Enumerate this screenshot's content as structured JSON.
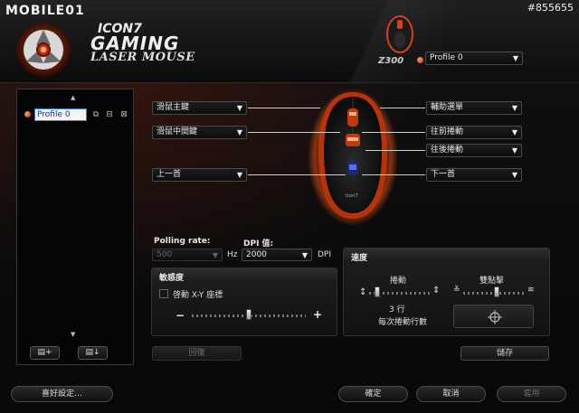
{
  "watermark": {
    "text": "MOBILE01",
    "photo_id": "#855655"
  },
  "brand": {
    "sub": "ICON7",
    "title": "GAMING",
    "tag": "LASER MOUSE"
  },
  "model": {
    "name": "Z300",
    "profile_selected": "Profile 0"
  },
  "profiles": {
    "items": [
      {
        "name": "Profile 0"
      }
    ],
    "add_button": "▤+",
    "import_button": "▤↓"
  },
  "buttons_map": {
    "left": [
      {
        "label": "滑鼠主鍵"
      },
      {
        "label": "滑鼠中間鍵"
      },
      {
        "label": "上一首"
      }
    ],
    "right": [
      {
        "label": "輔助選單"
      },
      {
        "label": "往前捲動"
      },
      {
        "label": "往後捲動"
      },
      {
        "label": "下一首"
      }
    ]
  },
  "polling": {
    "label": "Polling rate:",
    "value": "500",
    "unit": "Hz"
  },
  "dpi": {
    "label": "DPI 值:",
    "value": "2000",
    "unit": "DPI"
  },
  "sensitivity": {
    "title": "敏感度",
    "checkbox_label": "啓動 X-Y 座標",
    "checked": false,
    "minus": "−",
    "plus": "+",
    "level": 0.5,
    "reset_button": "回復"
  },
  "speed": {
    "title": "速度",
    "scroll_label": "捲動",
    "scroll_level": 0.1,
    "scroll_value": "3 行",
    "scroll_caption": "每次捲動行數",
    "double_click_label": "雙點擊",
    "double_click_level": 0.55,
    "save_button": "儲存"
  },
  "footer": {
    "preferences": "喜好設定…",
    "ok": "確定",
    "cancel": "取消",
    "apply": "套用"
  },
  "colors": {
    "accent": "#d9401a",
    "glow": "#c0390f"
  }
}
